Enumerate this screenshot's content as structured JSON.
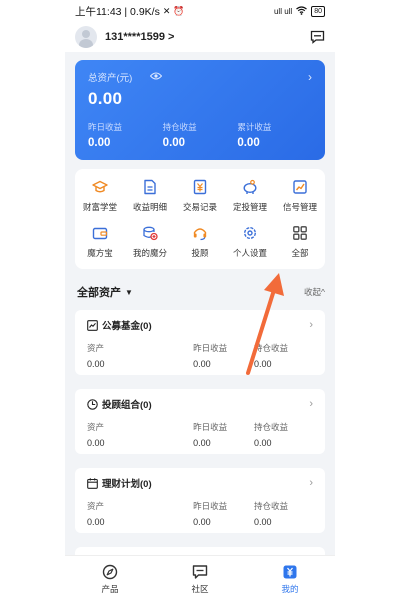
{
  "status_bar": {
    "time_speed": "上午11:43 | 0.9K/s",
    "signal": "ull ull",
    "battery": "80"
  },
  "header": {
    "username": "131****1599 >"
  },
  "assets": {
    "title": "总资产(元)",
    "total": "0.00",
    "stats": [
      {
        "label": "昨日收益",
        "value": "0.00"
      },
      {
        "label": "持仓收益",
        "value": "0.00"
      },
      {
        "label": "累计收益",
        "value": "0.00"
      }
    ]
  },
  "features": [
    {
      "label": "财富学堂",
      "icon": "graduation-cap-icon"
    },
    {
      "label": "收益明细",
      "icon": "document-icon"
    },
    {
      "label": "交易记录",
      "icon": "yuan-receipt-icon"
    },
    {
      "label": "定投管理",
      "icon": "piggy-bank-icon"
    },
    {
      "label": "信号管理",
      "icon": "chart-icon"
    },
    {
      "label": "魔方宝",
      "icon": "wallet-icon"
    },
    {
      "label": "我的魔分",
      "icon": "coins-icon"
    },
    {
      "label": "投顾",
      "icon": "headset-icon"
    },
    {
      "label": "个人设置",
      "icon": "gear-icon"
    },
    {
      "label": "全部",
      "icon": "grid-icon"
    }
  ],
  "section": {
    "title": "全部资产",
    "collapse": "收起^"
  },
  "funds": [
    {
      "title": "公募基金(0)",
      "labels": [
        "资产",
        "昨日收益",
        "持仓收益"
      ],
      "values": [
        "0.00",
        "0.00",
        "0.00"
      ]
    },
    {
      "title": "投顾组合(0)",
      "labels": [
        "资产",
        "昨日收益",
        "持仓收益"
      ],
      "values": [
        "0.00",
        "0.00",
        "0.00"
      ]
    },
    {
      "title": "理财计划(0)",
      "labels": [
        "资产",
        "昨日收益",
        "持仓收益"
      ],
      "values": [
        "0.00",
        "0.00",
        "0.00"
      ]
    }
  ],
  "nav": [
    {
      "label": "产品"
    },
    {
      "label": "社区"
    },
    {
      "label": "我的"
    }
  ],
  "colors": {
    "accent": "#2f76ec",
    "icon_orange": "#f08a24",
    "icon_blue": "#3b6fd8",
    "annotation": "#f26b3a"
  }
}
